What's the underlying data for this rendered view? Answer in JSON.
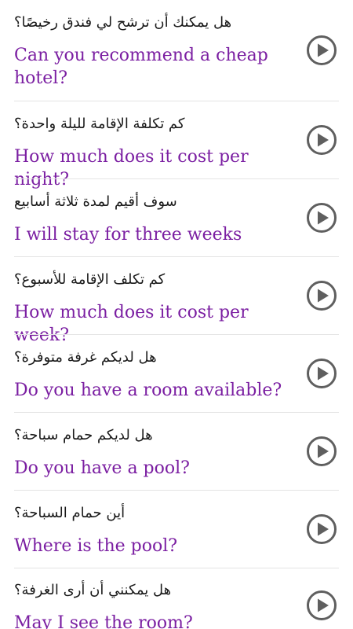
{
  "phrases": [
    {
      "arabic": "هل يمكنك أن ترشح لي فندق رخيصًا؟",
      "english": "Can you recommend a cheap hotel?",
      "play_icon": "play-circle-icon"
    },
    {
      "arabic": "كم تكلفة الإقامة لليلة واحدة؟",
      "english": "How much does it cost per night?",
      "play_icon": "play-circle-icon"
    },
    {
      "arabic": "سوف أقيم لمدة ثلاثة أسابيع",
      "english": "I will stay for three weeks",
      "play_icon": "play-circle-icon"
    },
    {
      "arabic": "كم تكلف الإقامة للأسبوع؟",
      "english": "How much does it cost per week?",
      "play_icon": "play-circle-icon"
    },
    {
      "arabic": "هل لديكم غرفة متوفرة؟",
      "english": "Do you have a room available?",
      "play_icon": "play-circle-icon"
    },
    {
      "arabic": "هل لديكم حمام سباحة؟",
      "english": "Do you have a pool?",
      "play_icon": "play-circle-icon"
    },
    {
      "arabic": "أين حمام السباحة؟",
      "english": "Where is the pool?",
      "play_icon": "play-circle-icon"
    },
    {
      "arabic": "هل يمكنني أن أرى الغرفة؟",
      "english": "May I see the room?",
      "play_icon": "play-circle-icon"
    }
  ],
  "colors": {
    "english_text": "#7b1fa2",
    "arabic_text": "#1a1a1a",
    "play_icon": "#5f5f5f",
    "divider": "#e4e4e4"
  }
}
